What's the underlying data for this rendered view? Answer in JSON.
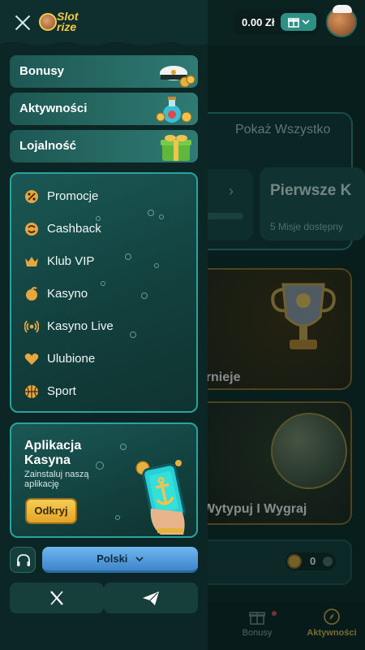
{
  "header": {
    "logo_line1": "Slot",
    "logo_line2": "rize",
    "balance": "0.00 Zł"
  },
  "categories": [
    {
      "label": "Bonusy",
      "icon": "captain-hat-coins-icon"
    },
    {
      "label": "Aktywności",
      "icon": "potion-icon"
    },
    {
      "label": "Lojalność",
      "icon": "gift-box-icon"
    }
  ],
  "menu": [
    {
      "label": "Promocje",
      "icon": "percent-icon"
    },
    {
      "label": "Cashback",
      "icon": "cashback-icon"
    },
    {
      "label": "Klub VIP",
      "icon": "crown-icon"
    },
    {
      "label": "Kasyno",
      "icon": "casino-icon"
    },
    {
      "label": "Kasyno Live",
      "icon": "live-broadcast-icon"
    },
    {
      "label": "Ulubione",
      "icon": "heart-icon"
    },
    {
      "label": "Sport",
      "icon": "basketball-icon"
    }
  ],
  "app_promo": {
    "title_line1": "Aplikacja",
    "title_line2": "Kasyna",
    "subtitle_line1": "Zainstaluj naszą",
    "subtitle_line2": "aplikację",
    "button": "Odkryj"
  },
  "language": "Polski",
  "background": {
    "show_all": "Pokaż Wszystko",
    "mission_title": "Pierwsze K",
    "mission_sub": "5 Misje dostępny",
    "card1_label": "urnieje",
    "card2_label": "Wytypuj I Wygraj",
    "coins": "0"
  },
  "bottom_nav": [
    {
      "label": "Bonusy",
      "icon": "gift-icon"
    },
    {
      "label": "Aktywności",
      "icon": "compass-icon"
    }
  ],
  "colors": {
    "accent_gold": "#f5c94a",
    "panel_border": "#2aa2a0",
    "language_button": "#4f9ad9"
  }
}
